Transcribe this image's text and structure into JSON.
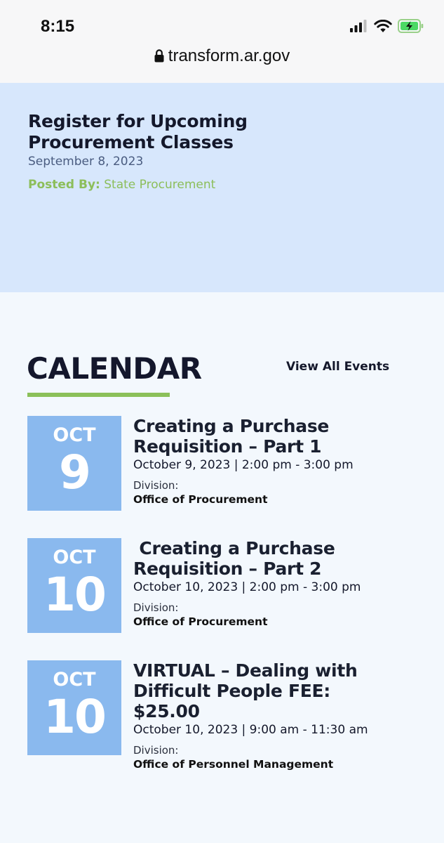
{
  "status": {
    "time": "8:15",
    "icons": [
      "cellular-signal-icon",
      "wifi-icon",
      "battery-charging-icon"
    ]
  },
  "browser": {
    "url": "transform.ar.gov",
    "secure_icon": "lock-icon"
  },
  "post": {
    "title": "Register for Upcoming Procurement Classes",
    "date": "September 8, 2023",
    "posted_by_label": "Posted By:",
    "posted_by_value": "State Procurement"
  },
  "calendar": {
    "heading": "CALENDAR",
    "view_all": "View All Events",
    "events": [
      {
        "month": "OCT",
        "day": "9",
        "title": "Creating a Purchase Requisition – Part 1",
        "time": "October 9, 2023 | 2:00 pm - 3:00 pm",
        "division_label": "Division:",
        "division": "Office of Procurement"
      },
      {
        "month": "OCT",
        "day": "10",
        "title": " Creating a Purchase Requisition – Part 2",
        "time": "October 10, 2023 | 2:00 pm - 3:00 pm",
        "division_label": "Division:",
        "division": "Office of Procurement"
      },
      {
        "month": "OCT",
        "day": "10",
        "title": "VIRTUAL – Dealing with Difficult People FEE: $25.00",
        "time": "October 10, 2023 | 9:00 am - 11:30 am",
        "division_label": "Division:",
        "division": "Office of Personnel Management"
      }
    ]
  },
  "colors": {
    "banner_bg": "#d7e7fc",
    "accent_green": "#8bc059",
    "tile_blue": "#8ab9ee",
    "heading_navy": "#14172c"
  }
}
